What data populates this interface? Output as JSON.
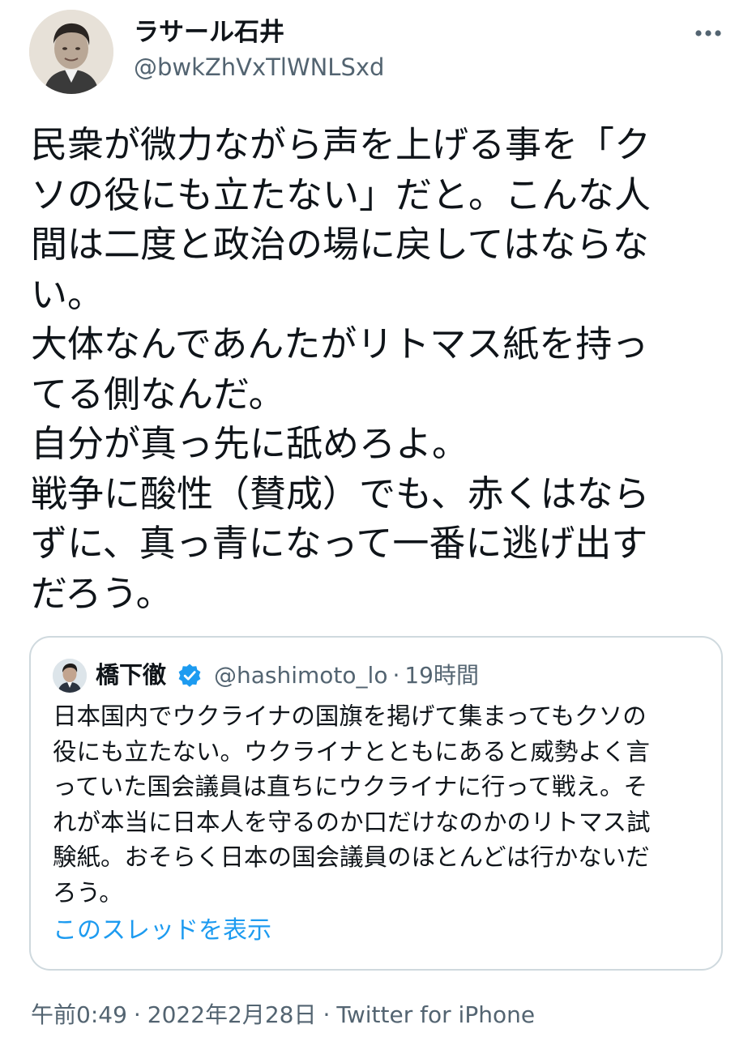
{
  "author": {
    "name": "ラサール石井",
    "handle": "@bwkZhVxTlWNLSxd"
  },
  "more_icon": "more-horizontal-icon",
  "tweet_lines": [
    "民衆が微力ながら声を上げる事を「ク",
    "ソの役にも立たない」だと。こんな人",
    "間は二度と政治の場に戻してはならな",
    "い。",
    "大体なんであんたがリトマス紙を持っ",
    "てる側なんだ。",
    "自分が真っ先に舐めろよ。",
    "戦争に酸性（賛成）でも、赤くはなら",
    "ずに、真っ青になって一番に逃げ出す",
    "だろう。"
  ],
  "quote": {
    "name": "橋下徹",
    "verified_icon": "verified-badge-icon",
    "handle": "@hashimoto_lo",
    "separator": "·",
    "time": "19時間",
    "lines": [
      "日本国内でウクライナの国旗を掲げて集まってもクソの",
      "役にも立たない。ウクライナとともにあると威勢よく言",
      "っていた国会議員は直ちにウクライナに行って戦え。そ",
      "れが本当に日本人を守るのか口だけなのかのリトマス試",
      "験紙。おそらく日本の国会議員のほとんどは行かないだ",
      "ろう。"
    ],
    "show_thread": "このスレッドを表示"
  },
  "meta": {
    "time": "午前0:49",
    "separator": "·",
    "date": "2022年2月28日",
    "source": "Twitter for iPhone"
  },
  "colors": {
    "text": "#0f1419",
    "secondary": "#536471",
    "link": "#1d9bf0",
    "border": "#cfd9de"
  }
}
